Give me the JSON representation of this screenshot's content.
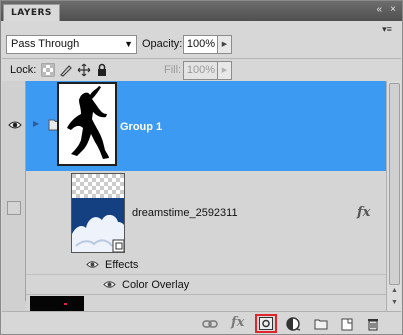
{
  "panel": {
    "tab_title": "LAYERS",
    "window_buttons": {
      "collapse": "«",
      "close": "×"
    },
    "menu_glyph": "▾≡"
  },
  "blend": {
    "mode": "Pass Through",
    "opacity_label": "Opacity:",
    "opacity_value": "100%",
    "lock_label": "Lock:",
    "fill_label": "Fill:",
    "fill_value": "100%"
  },
  "layers": [
    {
      "name": "Group 1",
      "type": "group",
      "selected": true,
      "visible": true
    },
    {
      "name": "dreamstime_2592311",
      "type": "smart-object",
      "selected": false,
      "visible": false,
      "fx": "fx"
    }
  ],
  "effects": {
    "label": "Effects",
    "items": [
      {
        "label": "Color Overlay"
      }
    ]
  },
  "toolbar": {
    "icons": [
      "link-layers-icon",
      "add-style-icon",
      "add-mask-icon",
      "adjustment-layer-icon",
      "new-group-icon",
      "new-layer-icon",
      "delete-layer-icon"
    ],
    "fx_text": "fx"
  },
  "colors": {
    "selected_row": "#3d9af3",
    "mask_button_highlight": "#e0262b"
  }
}
